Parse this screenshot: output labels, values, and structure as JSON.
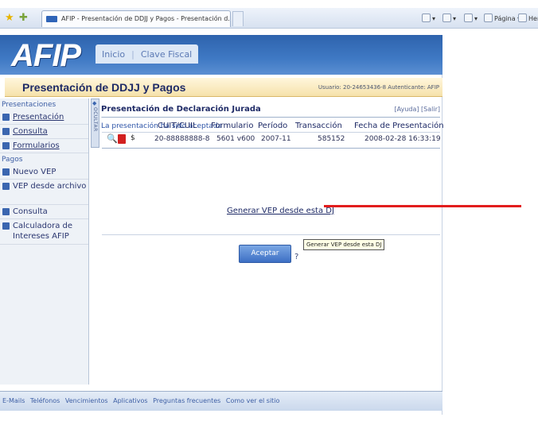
{
  "browser": {
    "tab_title": "AFIP - Presentación de DDJJ y Pagos - Presentación d...",
    "commands": [
      {
        "label": "▾",
        "icon": "home-icon"
      },
      {
        "label": "▾",
        "icon": "feed-icon"
      },
      {
        "label": "▾",
        "icon": "print-icon"
      },
      {
        "label": "Página ▾",
        "icon": "page-icon"
      },
      {
        "label": "Herr",
        "icon": "tools-icon"
      }
    ]
  },
  "header": {
    "logo": "AFIP",
    "nav": [
      "Inicio",
      "Clave Fiscal"
    ]
  },
  "titlebar": {
    "title": "Presentación de DDJJ y Pagos",
    "user": "Usuario: 20-24653436-8 Autenticante: AFIP"
  },
  "sidebar": {
    "section1": "Presentaciones",
    "items1": [
      "Presentación",
      "Consulta",
      "Formularios"
    ],
    "section2": "Pagos",
    "items2": [
      "Nuevo VEP",
      "VEP desde archivo",
      "Consulta",
      "Calculadora de Intereses AFIP"
    ],
    "collapse_label": "OCULTAR"
  },
  "panel": {
    "title": "Presentación de Declaración Jurada",
    "links": "[Ayuda] [Salir]",
    "message": "La presentación ha sido aceptada"
  },
  "table": {
    "headers": [
      "CUIT/CUIL",
      "Formulario",
      "Período",
      "Transacción",
      "Fecha de Presentación"
    ],
    "row": {
      "dollar": "$",
      "cuit": "20-88888888-8",
      "formulario": "5601 v600",
      "periodo": "2007-11",
      "transaccion": "585152",
      "fecha": "2008-02-28 16:33:19"
    }
  },
  "actions": {
    "generate_link": "Generar VEP desde esta DJ",
    "tooltip": "Generar VEP desde esta DJ",
    "accept_button": "Aceptar",
    "help": "?"
  },
  "footer": {
    "links": [
      "E-Mails",
      "Teléfonos",
      "Vencimientos",
      "Aplicativos",
      "Preguntas frecuentes",
      "Como ver el sitio"
    ]
  },
  "colors": {
    "header_blue": "#3f79c4",
    "title_band": "#f6e2ab",
    "arrow_red": "#e21d1d"
  }
}
